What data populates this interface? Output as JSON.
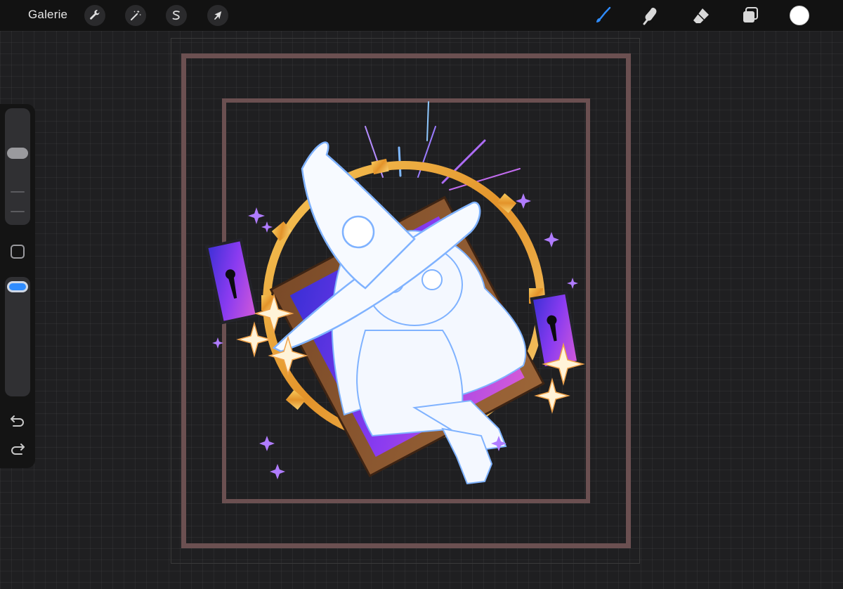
{
  "toolbar": {
    "gallery_label": "Galerie",
    "left_tools": [
      {
        "name": "actions",
        "icon": "wrench-icon"
      },
      {
        "name": "adjustments",
        "icon": "magic-wand-icon"
      },
      {
        "name": "selection",
        "icon": "selection-s-icon"
      },
      {
        "name": "transform",
        "icon": "arrow-cursor-icon"
      }
    ],
    "right_tools": [
      {
        "name": "brush",
        "icon": "brush-icon",
        "active": true
      },
      {
        "name": "smudge",
        "icon": "smudge-finger-icon",
        "active": false
      },
      {
        "name": "eraser",
        "icon": "eraser-icon",
        "active": false
      },
      {
        "name": "layers",
        "icon": "layers-icon",
        "active": false
      }
    ],
    "current_color": "#ffffff",
    "active_color": "#2f8cff"
  },
  "sidebar": {
    "brush_size_level": 0.65,
    "opacity_level": 0.95,
    "modify_button": "square-modify-icon",
    "undo_icon": "undo-arrow-icon",
    "redo_icon": "redo-arrow-icon"
  },
  "canvas": {
    "frame_color": "#6b5051",
    "artwork": "chibi-witch-lineart-with-gear-and-frame"
  }
}
